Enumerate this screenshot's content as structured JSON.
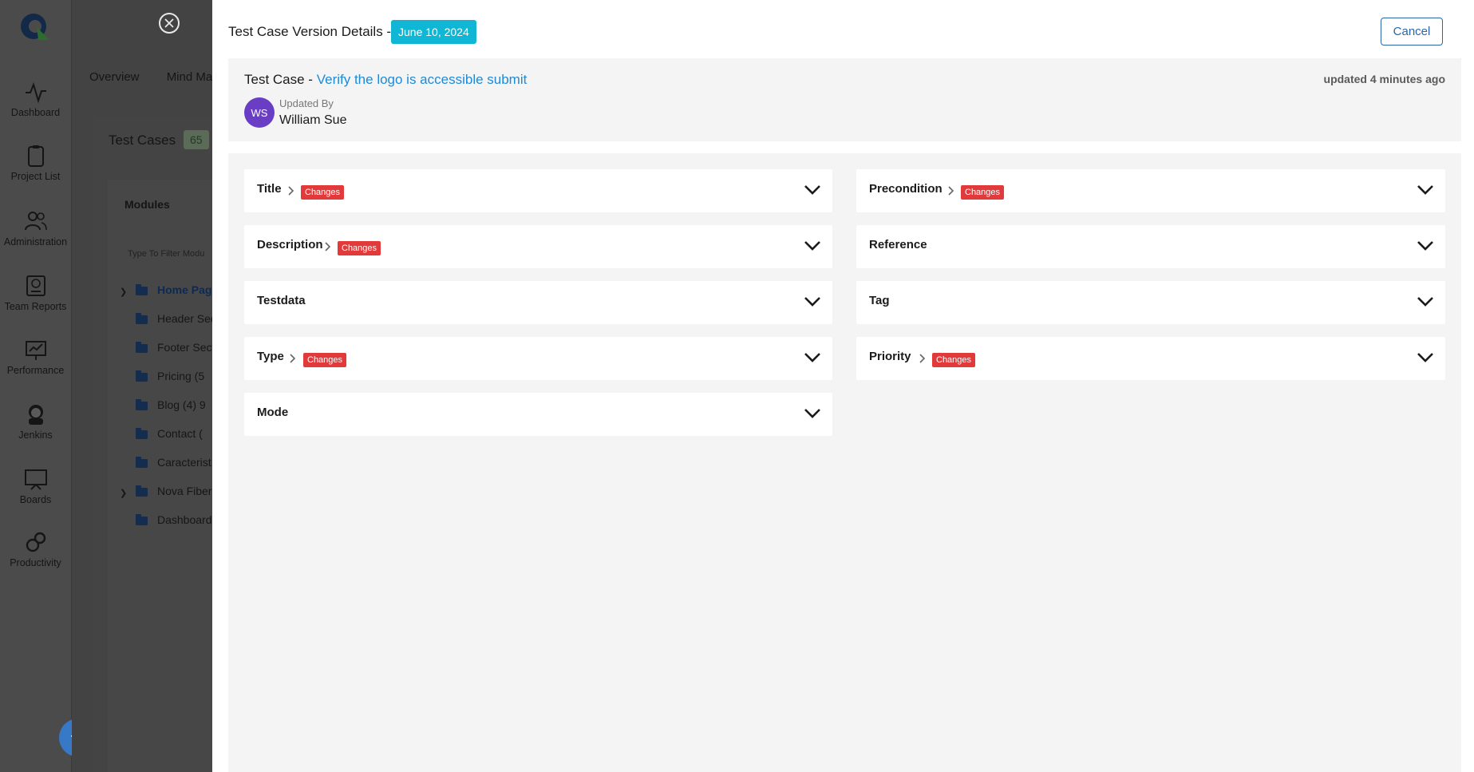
{
  "nav": {
    "items": [
      {
        "label": "Dashboard"
      },
      {
        "label": "Project List"
      },
      {
        "label": "Administration"
      },
      {
        "label": "Team Reports"
      },
      {
        "label": "Performance"
      },
      {
        "label": "Jenkins"
      },
      {
        "label": "Boards"
      },
      {
        "label": "Productivity"
      }
    ]
  },
  "background": {
    "tabs": [
      "Overview",
      "Mind Map"
    ],
    "test_cases_title": "Test Cases",
    "test_cases_count": "65",
    "modules_title": "Modules",
    "filter_placeholder": "Type To Filter Modu",
    "tree": [
      {
        "label": "Home Page",
        "expandable": true,
        "active": true
      },
      {
        "label": "Header Sec"
      },
      {
        "label": "Footer Sect"
      },
      {
        "label": "Pricing (5"
      },
      {
        "label": "Blog (4) 9"
      },
      {
        "label": "Contact ("
      },
      {
        "label": "Caracterist"
      },
      {
        "label": "Nova Fiber",
        "expandable": true
      },
      {
        "label": "Dashboard"
      }
    ]
  },
  "modal": {
    "title": "Test Case Version Details -",
    "date": "June 10, 2024",
    "cancel_label": "Cancel",
    "test_case_prefix": "Test Case -",
    "test_case_name": "Verify the logo is accessible submit",
    "updated_ago": "updated 4 minutes ago",
    "avatar_initials": "WS",
    "updated_by_label": "Updated By",
    "updated_by_name": "William Sue",
    "change_label": "Changes",
    "sections": {
      "title": {
        "label": "Title",
        "changed": true
      },
      "description": {
        "label": "Description",
        "changed": true
      },
      "testdata": {
        "label": "Testdata",
        "changed": false
      },
      "type": {
        "label": "Type",
        "changed": true
      },
      "mode": {
        "label": "Mode",
        "changed": false
      },
      "precondition": {
        "label": "Precondition",
        "changed": true
      },
      "reference": {
        "label": "Reference",
        "changed": false
      },
      "tag": {
        "label": "Tag",
        "changed": false
      },
      "priority": {
        "label": "Priority",
        "changed": true
      }
    }
  },
  "colors": {
    "accent": "#1f8ad6",
    "date_badge": "#0fb7d4",
    "change_badge": "#e23a3a",
    "avatar": "#6a3ec4",
    "bulb_button": "#3778c7"
  }
}
